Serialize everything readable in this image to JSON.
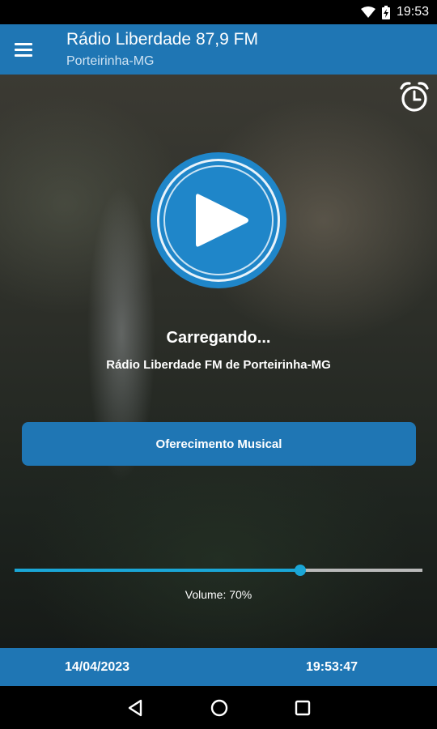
{
  "status_bar": {
    "time": "19:53",
    "icons": [
      "wifi-icon",
      "battery-charging-icon"
    ]
  },
  "app_bar": {
    "menu_icon": "hamburger-menu-icon",
    "title": "Rádio Liberdade 87,9 FM",
    "subtitle": "Porteirinha-MG"
  },
  "player": {
    "alarm_icon": "alarm-clock-icon",
    "play_icon": "play-icon",
    "status": "Carregando...",
    "station": "Rádio Liberdade FM de Porteirinha-MG",
    "offer_button": "Oferecimento Musical"
  },
  "volume": {
    "level": 0.7,
    "label": "Volume: 70%"
  },
  "footer": {
    "date": "14/04/2023",
    "time": "19:53:47"
  },
  "nav_bar": {
    "icons": [
      "back-icon",
      "home-icon",
      "recents-icon"
    ]
  },
  "colors": {
    "primary": "#1f76b4",
    "play_button": "#1f86c9",
    "volume_accent": "#1aa6d6"
  }
}
